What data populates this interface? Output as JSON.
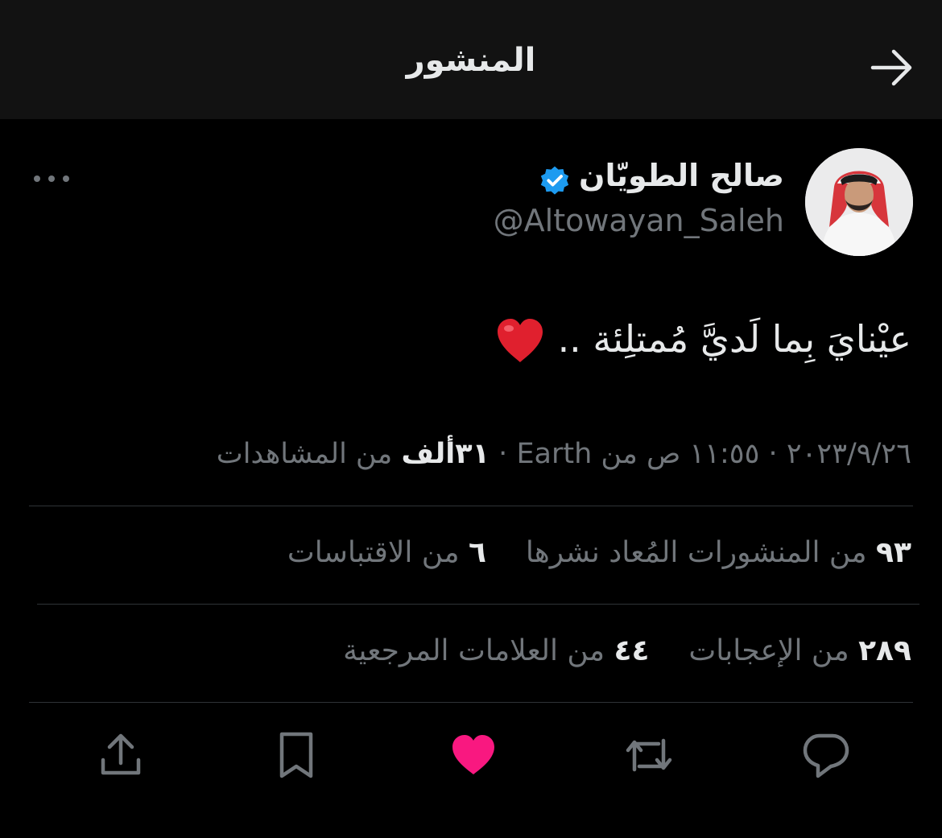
{
  "header": {
    "title": "المنشور",
    "back_icon": "arrow-right-icon"
  },
  "author": {
    "display_name": "صالح الطويّان",
    "handle": "@Altowayan_Saleh",
    "verified_color": "#1d9bf0"
  },
  "post": {
    "text": "عيْنايَ بِما لَديَّ مُمتلِئة .."
  },
  "meta": {
    "date": "٢٠٢٣/٩/٢٦",
    "separator": "·",
    "time": "١١:٥٥ ص من Earth",
    "views_count": "٣١ألف",
    "views_label": "من المشاهدات"
  },
  "stats_row1": {
    "reposts_count": "٩٣",
    "reposts_label": "من المنشورات المُعاد نشرها",
    "quotes_count": "٦",
    "quotes_label": "من الاقتباسات"
  },
  "stats_row2": {
    "likes_count": "٢٨٩",
    "likes_label": "من الإعجابات",
    "bookmarks_count": "٤٤",
    "bookmarks_label": "من العلامات المرجعية"
  },
  "actions": {
    "reply_icon": "reply-icon",
    "repost_icon": "repost-icon",
    "like_icon": "heart-icon",
    "bookmark_icon": "bookmark-icon",
    "share_icon": "share-icon",
    "like_color": "#f91880"
  }
}
